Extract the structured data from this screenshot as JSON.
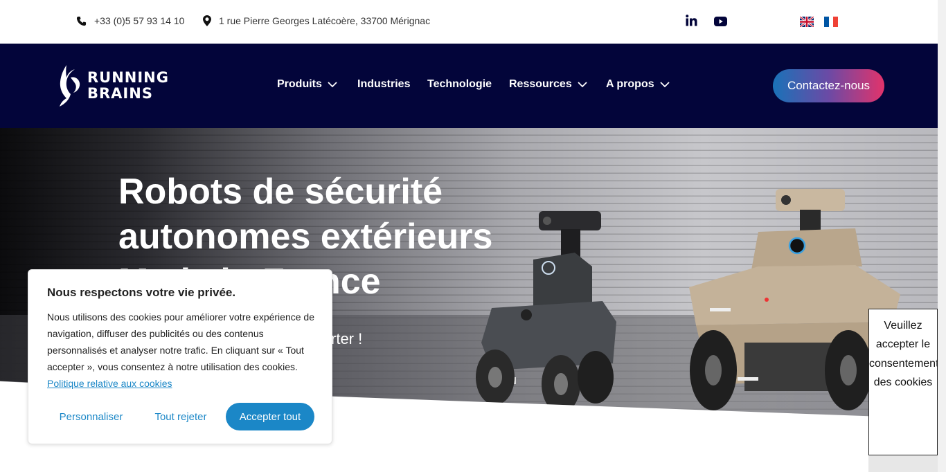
{
  "topbar": {
    "phone": "+33 (0)5 57 93 14 10",
    "phone_icon": "phone-icon",
    "address": "1 rue Pierre Georges Latécoère, 33700 Mérignac",
    "address_icon": "map-pin-icon",
    "social": [
      "linkedin-icon",
      "youtube-icon"
    ],
    "languages": [
      "English",
      "Français"
    ]
  },
  "nav": {
    "logo_line1": "RUNNING",
    "logo_line2": "BRAINS",
    "items": [
      {
        "label": "Produits",
        "has_dropdown": true
      },
      {
        "label": "Industries",
        "has_dropdown": false
      },
      {
        "label": "Technologie",
        "has_dropdown": false
      },
      {
        "label": "Ressources",
        "has_dropdown": true
      },
      {
        "label": "A propos",
        "has_dropdown": true
      }
    ],
    "cta": "Contactez-nous"
  },
  "hero": {
    "title_line1": "Robots de sécurité",
    "title_line2": "autonomes extérieurs",
    "title_line3": "Made in France",
    "subtitle_visible": "rter !"
  },
  "cookie": {
    "title": "Nous respectons votre vie privée.",
    "body": "Nous utilisons des cookies pour améliorer votre expérience de navigation, diffuser des publicités ou des contenus personnalisés et analyser notre trafic. En cliquant sur « Tout accepter », vous consentez à notre utilisation des cookies.",
    "policy_link": "Politique relative aux cookies",
    "btn_customize": "Personnaliser",
    "btn_reject": "Tout rejeter",
    "btn_accept": "Accepter tout"
  },
  "consent_notice": "Veuillez accepter le consentement des cookies",
  "colors": {
    "nav_bg": "#03053a",
    "cookie_accent": "#1b87c7",
    "cta_gradient_start": "#1a72b8",
    "cta_gradient_end": "#e2336b"
  }
}
